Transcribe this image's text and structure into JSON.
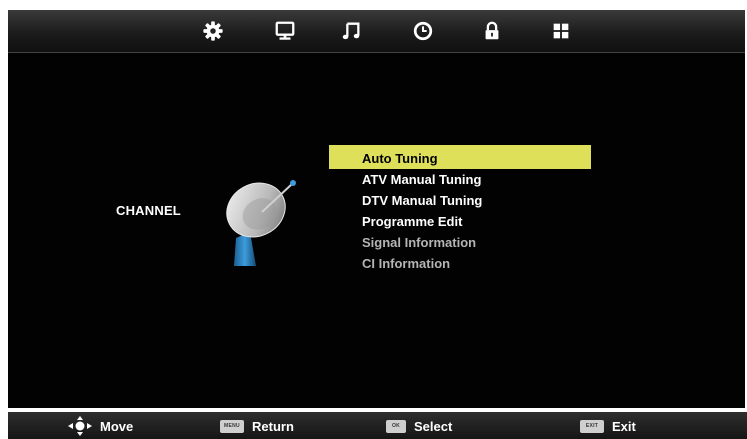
{
  "top_tabs": [
    {
      "icon": "settings-gear-icon",
      "active": true
    },
    {
      "icon": "monitor-icon"
    },
    {
      "icon": "music-note-icon"
    },
    {
      "icon": "clock-icon"
    },
    {
      "icon": "lock-icon"
    },
    {
      "icon": "grid-icon"
    }
  ],
  "section": {
    "title": "CHANNEL",
    "icon": "satellite-dish-icon"
  },
  "menu": {
    "items": [
      {
        "label": "Auto Tuning",
        "selected": true
      },
      {
        "label": "ATV Manual Tuning"
      },
      {
        "label": "DTV Manual Tuning"
      },
      {
        "label": "Programme Edit"
      },
      {
        "label": "Signal Information",
        "disabled": true
      },
      {
        "label": "CI Information",
        "disabled": true
      }
    ]
  },
  "footer": {
    "move": {
      "label": "Move",
      "icon": "dpad-icon"
    },
    "return": {
      "label": "Return",
      "key_text": "MENU"
    },
    "select": {
      "label": "Select",
      "key_text": "OK"
    },
    "exit": {
      "label": "Exit",
      "key_text": "EXIT"
    }
  },
  "colors": {
    "highlight": "#dfe05a",
    "background": "#020202",
    "disabled_text": "#b5b5b5"
  }
}
